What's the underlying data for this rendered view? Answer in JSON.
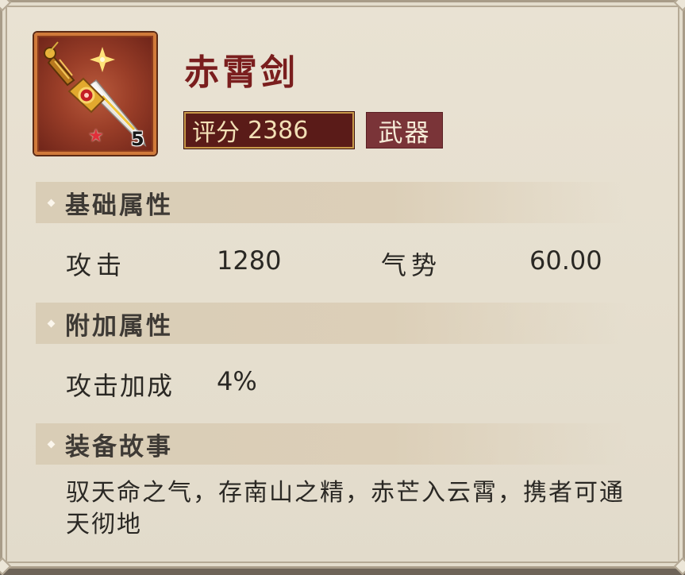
{
  "item": {
    "name": "赤霄剑",
    "score_label": "评分",
    "score_value": "2386",
    "type_tag": "武器",
    "level": "5",
    "icon": "red-gold-sword-icon",
    "star_icon": "red-star-icon"
  },
  "sections": {
    "base": {
      "title": "基础属性"
    },
    "extra": {
      "title": "附加属性"
    },
    "story": {
      "title": "装备故事"
    }
  },
  "base_stats": [
    {
      "label": "攻击",
      "value": "1280"
    },
    {
      "label": "气势",
      "value": "60.00"
    }
  ],
  "extra_stats": [
    {
      "label": "攻击加成",
      "value": "4%"
    }
  ],
  "story_text": "驭天命之气，存南山之精，赤芒入云霄，携者可通天彻地",
  "colors": {
    "panel_bg": "#e6dfcf",
    "name_red": "#7a1e1e",
    "score_bg": "#5a1b18",
    "tag_bg": "#7a3438",
    "section_bg": "#d9cdb6",
    "frame_orange": "#d07a3a"
  }
}
